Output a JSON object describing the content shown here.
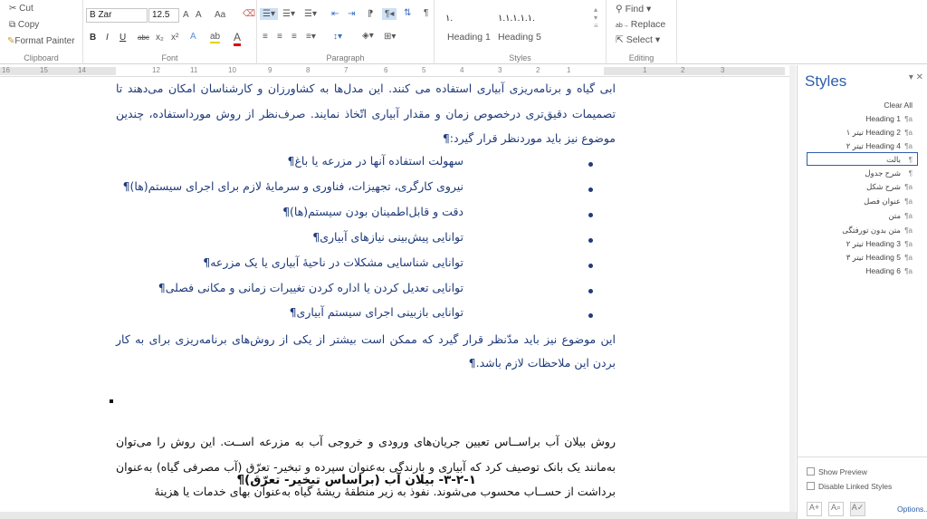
{
  "ribbon": {
    "clipboard": {
      "cut": "Cut",
      "copy": "Copy",
      "format_painter": "Format Painter",
      "label": "Clipboard"
    },
    "font": {
      "name": "B Zar",
      "size": "12.5",
      "label": "Font",
      "bold": "B",
      "italic": "I",
      "underline": "U",
      "strike": "abc",
      "subscript": "x₂",
      "superscript": "x²",
      "change_case": "Aa",
      "grow": "A",
      "shrink": "A",
      "font_color": "A",
      "highlight": "ab"
    },
    "paragraph": {
      "label": "Paragraph",
      "show_marks": "¶"
    },
    "styles": {
      "label": "Styles",
      "items": [
        {
          "preview": "۱.",
          "name": "Heading 1"
        },
        {
          "preview": "۱.۱.۱.۱.۱.",
          "name": "Heading 5"
        }
      ]
    },
    "editing": {
      "label": "Editing",
      "find": "Find",
      "replace": "Replace",
      "select": "Select"
    }
  },
  "ruler": {
    "ticks": [
      "16",
      "15",
      "14",
      "12",
      "11",
      "10",
      "9",
      "8",
      "7",
      "6",
      "5",
      "4",
      "3",
      "2",
      "1",
      "1",
      "2",
      "3"
    ]
  },
  "document": {
    "para1": "ابی گیاه و برنامه‌ریزی آبیاری استفاده می کنند. این مدل‌ها به کشاورزان و کارشناسان امکان می‌دهند تا تصمیمات دقیق‌تری درخصوص زمان و مقدار آبیاری اتّخاذ نمایند. صرف‌نظر از روش مورداستفاده، چندین موضوع نیز باید موردنظر قرار گیرد:¶",
    "bullets": [
      "سهولت استفاده آنها در مزرعه یا باغ¶",
      "نیروی کارگری، تجهیزات، فناوری و سرمایهٔ لازم برای اجرای سیستم(ها)¶",
      "دقت و قابل‌اطمینان بودن سیستم(ها)¶",
      "توانایی پیش‌بینی نیازهای آبیاری¶",
      "توانایی شناسایی مشکلات در ناحیهٔ آبیاری یا یک مزرعه¶",
      "توانایی تعدیل کردن یا اداره کردن تغییرات زمانی و مکانی فصلی¶",
      "توانایی بازبینی اجرای سیستم آبیاری¶"
    ],
    "para2": "این موضوع نیز باید مدّنظر قرار گیرد که ممکن است بیشتر از یکی از روش‌های برنامه‌ریزی برای به کار بردن این ملاحظات لازم باشد.¶",
    "heading": "۳-۲-۱- بیلان آب (براساس تبخیر- تعرّق)¶",
    "para3": "روش بیلان آب براســاس تعیین جریان‌های ورودی و خروجی آب به مزرعه اســت. این روش را می‌توان به‌مانند یک بانک توصیف کرد که آبیاری و بارندگی به‌عنوان سپرده و تبخیر- تعرّق (آب مصرفی گیاه) به‌عنوان برداشت از حســاب محسوب می‌شوند. نفوذ به زیر منطقهٔ ریشهٔ گیاه به‌عنوان بهای خدمات یا هزینهٔ"
  },
  "styles_pane": {
    "title": "Styles",
    "clear_all": "Clear All",
    "items": [
      {
        "label": "Heading 1",
        "icon": "linked-style-icon"
      },
      {
        "label": "تیتر ۱ Heading 2",
        "icon": "linked-style-icon"
      },
      {
        "label": "تیتر ۲ Heading 4",
        "icon": "linked-style-icon"
      },
      {
        "label": "بالت",
        "icon": "paragraph-style-icon",
        "selected": true
      },
      {
        "label": "شرح جدول",
        "icon": "paragraph-style-icon"
      },
      {
        "label": "شرح شکل",
        "icon": "linked-style-icon"
      },
      {
        "label": "عنوان فصل",
        "icon": "linked-style-icon"
      },
      {
        "label": "متن",
        "icon": "linked-style-icon"
      },
      {
        "label": "متن بدون تورفتگی",
        "icon": "linked-style-icon"
      },
      {
        "label": "تیتر ۲ Heading 3",
        "icon": "linked-style-icon"
      },
      {
        "label": "تیتر ۳ Heading 5",
        "icon": "linked-style-icon"
      },
      {
        "label": "Heading 6",
        "icon": "linked-style-icon"
      }
    ],
    "show_preview": "Show Preview",
    "disable_linked": "Disable Linked Styles",
    "options": "Options..."
  },
  "colors": {
    "body_text": "#1f3b7a",
    "accent": "#2e5ea8"
  }
}
